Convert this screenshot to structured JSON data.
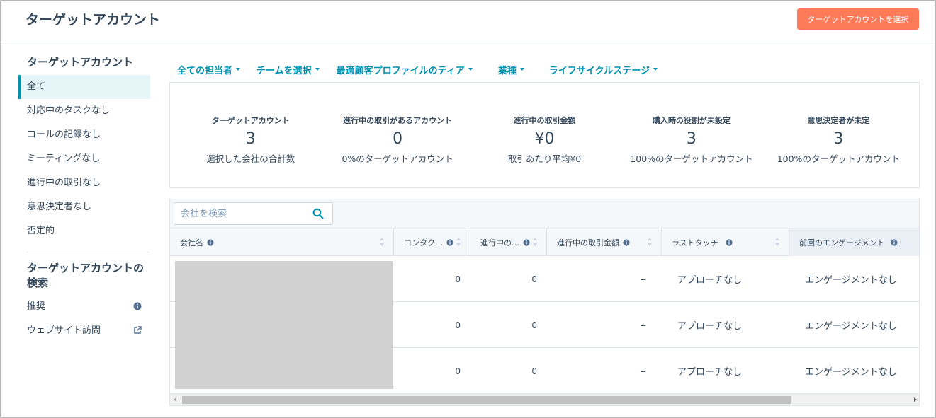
{
  "header": {
    "title": "ターゲットアカウント",
    "primary_button": "ターゲットアカウントを選択"
  },
  "sidebar": {
    "heading": "ターゲットアカウント",
    "items": [
      {
        "label": "全て",
        "active": true
      },
      {
        "label": "対応中のタスクなし"
      },
      {
        "label": "コールの記録なし"
      },
      {
        "label": "ミーティングなし"
      },
      {
        "label": "進行中の取引なし"
      },
      {
        "label": "意思決定者なし"
      },
      {
        "label": "否定的"
      }
    ],
    "search_heading": "ターゲットアカウントの検索",
    "search_items": [
      {
        "label": "推奨",
        "icon": "info-icon"
      },
      {
        "label": "ウェブサイト訪問",
        "icon": "external-link-icon"
      }
    ]
  },
  "filters": [
    {
      "label": "全ての担当者"
    },
    {
      "label": "チームを選択"
    },
    {
      "label": "最適顧客プロファイルのティア"
    },
    {
      "label": "業種"
    },
    {
      "label": "ライフサイクルステージ"
    }
  ],
  "kpis": [
    {
      "label": "ターゲットアカウント",
      "value": "3",
      "sub": "選択した会社の合計数"
    },
    {
      "label": "進行中の取引があるアカウント",
      "value": "0",
      "sub": "0%のターゲットアカウント"
    },
    {
      "label": "進行中の取引金額",
      "value": "¥0",
      "sub": "取引あたり平均¥0"
    },
    {
      "label": "購入時の役割が未設定",
      "value": "3",
      "sub": "100%のターゲットアカウント"
    },
    {
      "label": "意思決定者が未定",
      "value": "3",
      "sub": "100%のターゲットアカウント"
    }
  ],
  "table": {
    "search_placeholder": "会社を検索",
    "columns": [
      {
        "label": "会社名"
      },
      {
        "label": "コンタク…"
      },
      {
        "label": "進行中の…"
      },
      {
        "label": "進行中の取引金額"
      },
      {
        "label": "ラストタッチ"
      },
      {
        "label": "前回のエンゲージメント"
      }
    ],
    "rows": [
      {
        "contacts": "0",
        "open_deals": "0",
        "deal_amount": "--",
        "last_touch": "アプローチなし",
        "last_engagement": "エンゲージメントなし"
      },
      {
        "contacts": "0",
        "open_deals": "0",
        "deal_amount": "--",
        "last_touch": "アプローチなし",
        "last_engagement": "エンゲージメントなし"
      },
      {
        "contacts": "0",
        "open_deals": "0",
        "deal_amount": "--",
        "last_touch": "アプローチなし",
        "last_engagement": "エンゲージメントなし"
      }
    ]
  },
  "colors": {
    "accent": "#0091ae",
    "primary_button": "#ff7a59",
    "text": "#33475b"
  }
}
